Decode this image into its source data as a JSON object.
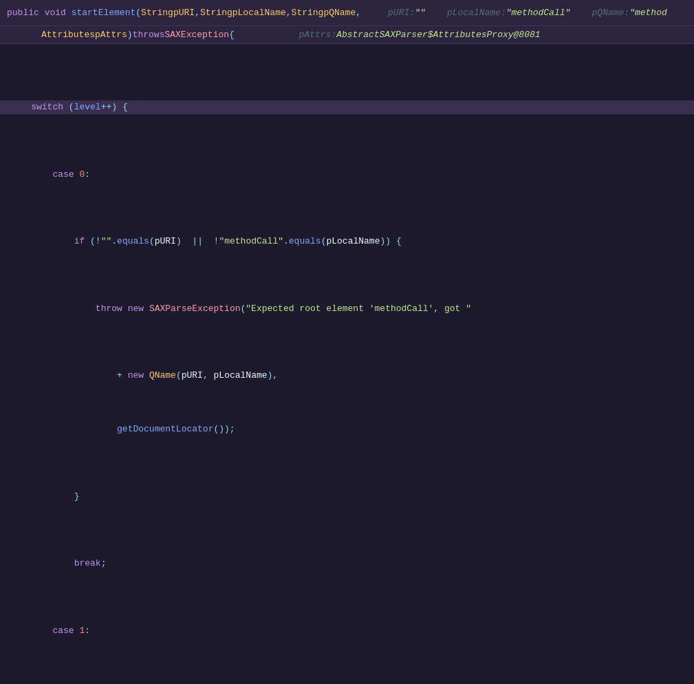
{
  "topBar": {
    "methodSignature": "public void startElement(String pURI, String pLocalName, String pQName,",
    "params": [
      {
        "name": "pURI",
        "value": "\"\""
      },
      {
        "name": "pLocalName",
        "value": "\"methodCall\""
      },
      {
        "name": "pQName",
        "value": "\"method"
      }
    ],
    "hintLine": "Attributes pAttrs) throws SAXException {",
    "hintParams": [
      {
        "name": "pAttrs",
        "value": "AbstractSAXParser$AttributesProxy@8081"
      }
    ]
  },
  "colors": {
    "background": "#1e1a2e",
    "topBar": "#2d2540",
    "highlighted": "#3a2f4e"
  }
}
